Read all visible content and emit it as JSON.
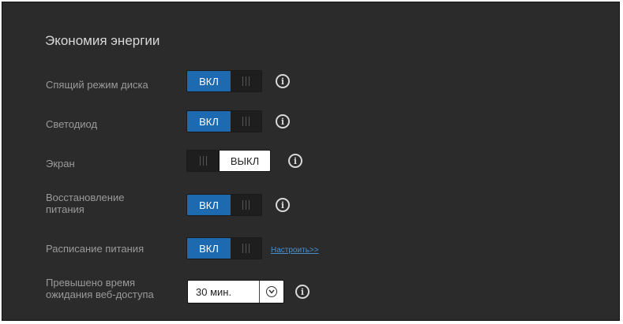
{
  "section": {
    "title": "Экономия энергии"
  },
  "rows": {
    "disk_sleep": {
      "label": "Спящий режим диска",
      "state": "ВКЛ"
    },
    "led": {
      "label": "Светодиод",
      "state": "ВКЛ"
    },
    "screen": {
      "label": "Экран",
      "state": "ВЫКЛ"
    },
    "power_recovery": {
      "label_line1": "Восстановление",
      "label_line2": "питания",
      "state": "ВКЛ"
    },
    "power_schedule": {
      "label": "Расписание питания",
      "state": "ВКЛ",
      "link": "Настроить>>"
    },
    "web_timeout": {
      "label_line1": "Превышено время",
      "label_line2": "ожидания веб-доступа",
      "value": "30 мин."
    }
  },
  "icons": {
    "info": "info-icon",
    "dropdown": "chevron-down-icon"
  },
  "colors": {
    "panel": "#2b2b2b",
    "accent": "#1e6ab0",
    "link": "#4a90d0"
  }
}
